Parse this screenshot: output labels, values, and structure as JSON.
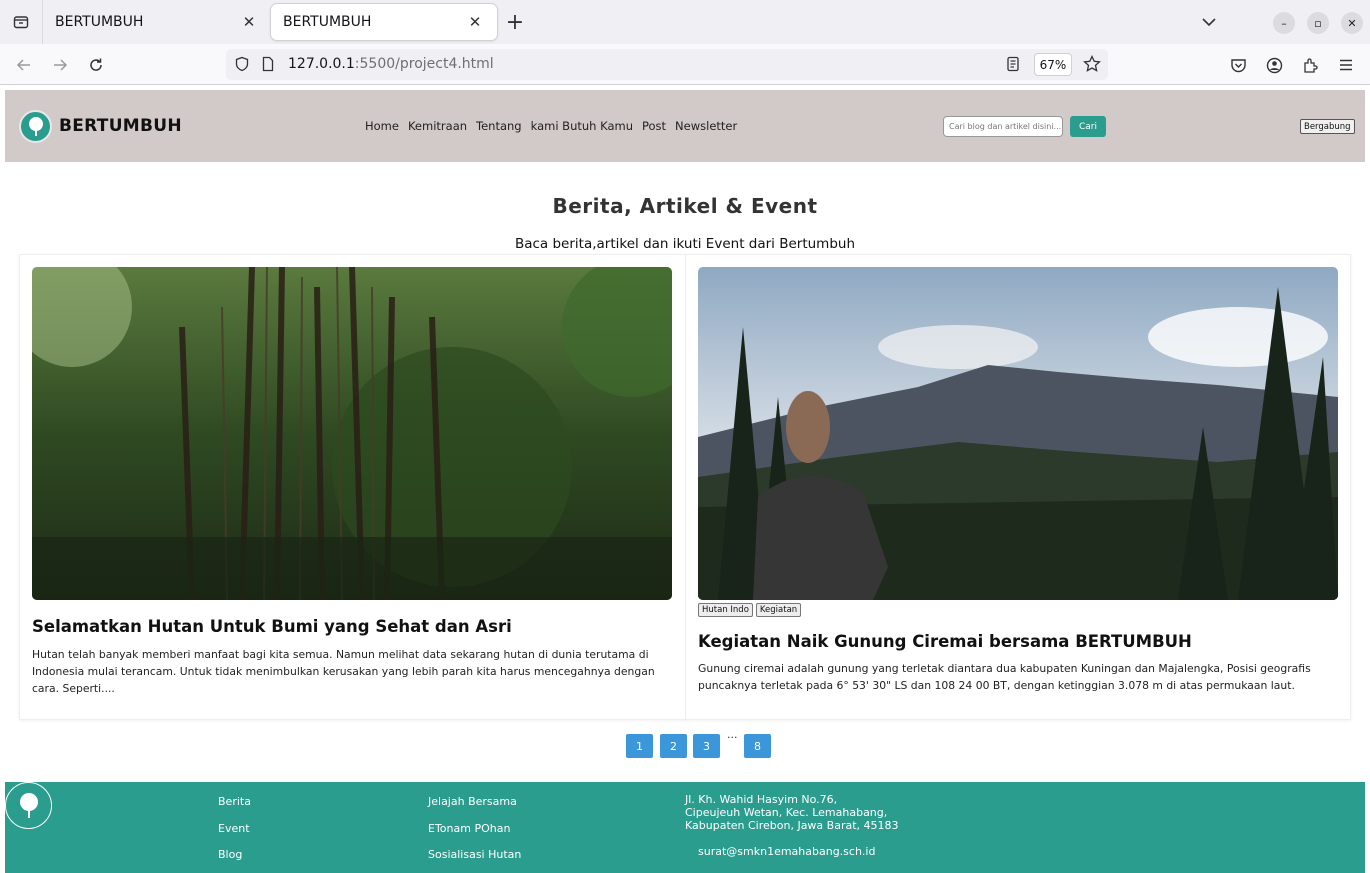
{
  "browser": {
    "tabs": [
      {
        "title": "BERTUMBUH",
        "active": false
      },
      {
        "title": "BERTUMBUH",
        "active": true
      }
    ],
    "url_host": "127.0.0.1",
    "url_rest": ":5500/project4.html",
    "zoom": "67%"
  },
  "header": {
    "brand": "BERTUMBUH",
    "nav": [
      "Home",
      "Kemitraan",
      "Tentang",
      "kami Butuh Kamu",
      "Post",
      "Newsletter"
    ],
    "search_placeholder": "Cari blog dan artikel disini...",
    "search_button": "Cari",
    "join_button": "Bergabung"
  },
  "section": {
    "title": "Berita, Artikel & Event",
    "subtitle": "Baca berita,artikel dan ikuti Event dari Bertumbuh"
  },
  "cards": [
    {
      "title": "Selamatkan Hutan Untuk Bumi yang Sehat dan Asri",
      "text": "Hutan telah banyak memberi manfaat bagi kita semua. Namun melihat data sekarang hutan di dunia terutama di Indonesia mulai terancam. Untuk tidak menimbulkan kerusakan yang lebih parah kita harus mencegahnya dengan cara. Seperti....",
      "tags": []
    },
    {
      "title": "Kegiatan Naik Gunung Ciremai bersama BERTUMBUH",
      "text": "Gunung ciremai adalah gunung yang terletak diantara dua kabupaten Kuningan dan Majalengka, Posisi geografis puncaknya terletak pada 6° 53' 30\" LS dan 108 24 00 BT, dengan ketinggian 3.078 m di atas permukaan laut.",
      "tags": [
        "Hutan Indo",
        "Kegiatan"
      ]
    }
  ],
  "pagination": {
    "pages": [
      "1",
      "2",
      "3",
      "8"
    ],
    "ellipsis": "..."
  },
  "footer": {
    "col1": [
      "Berita",
      "Event",
      "Blog"
    ],
    "col2": [
      "Jelajah Bersama",
      "ETonam POhan",
      "Sosialisasi Hutan"
    ],
    "address_lines": [
      "Jl. Kh. Wahid Hasyim No.76,",
      "Cipeujeuh Wetan, Kec. Lemahabang,",
      "Kabupaten Cirebon, Jawa Barat, 45183"
    ],
    "email": "surat@smkn1emahabang.sch.id"
  },
  "colors": {
    "accent": "#2a9d8f",
    "header_bg": "#d2c9c9",
    "pager": "#3b97d9"
  }
}
